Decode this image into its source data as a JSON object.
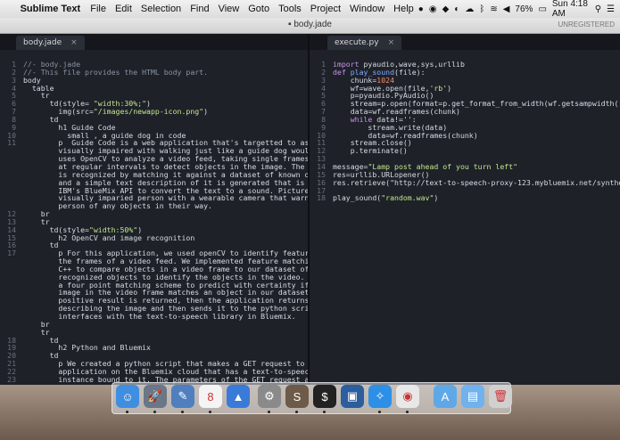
{
  "menubar": {
    "apple": "",
    "app": "Sublime Text",
    "items": [
      "File",
      "Edit",
      "Selection",
      "Find",
      "View",
      "Goto",
      "Tools",
      "Project",
      "Window",
      "Help"
    ],
    "battery": "76%",
    "clock": "Sun 4:18 AM"
  },
  "window": {
    "title": "body.jade",
    "unregistered": "UNREGISTERED"
  },
  "tabs": {
    "left": "body.jade",
    "right": "execute.py",
    "close": "×"
  },
  "left_lines": [
    "1",
    "2",
    "3",
    "4",
    "5",
    "6",
    "7",
    "8",
    "9",
    "10",
    "11",
    "",
    "",
    "",
    "",
    "",
    "",
    "",
    "",
    "12",
    "13",
    "14",
    "15",
    "16",
    "17",
    "",
    "",
    "",
    "",
    "",
    "",
    "",
    "",
    "",
    "",
    "18",
    "19",
    "20",
    "21",
    "22",
    "23"
  ],
  "left_code": [
    "//- body.jade",
    "//- This file provides the HTML body part.",
    "body",
    "  table",
    "    tr",
    "      td(style= \"width:30%;\")",
    "        img(src=\"/images/newapp-icon.png\")",
    "      td",
    "        h1 Guide Code",
    "          small , a guide dog in code",
    "        p  Guide Code is a web application that's targetted to assist the",
    "        visually impaired with walking just like a guide dog would. It",
    "        uses OpenCV to analyze a video feed, taking single frames from it",
    "        at regular intervals to detect objects in the image. The object",
    "        is recognized by matching it against a dataset of known objects,",
    "        and a simple text description of it is generated that is sent to",
    "        IBM's BlueMix API to convert the text to a sound. Picture a",
    "        visually imparied person with a wearable camera that warns the",
    "        person of any objects in their way.",
    "    br",
    "    tr",
    "      td(style=\"width:50%\")",
    "        h2 OpenCV and image recognition",
    "      td",
    "        p For this application, we used openCV to identify features in",
    "        the frames of a video feed. We implemented feature matching using",
    "        C++ to compare objects in a video frame to our dataset of",
    "        recognized objects to identify the objects in the video. We used",
    "        a four point matching scheme to predict with certainty if the",
    "        image in the video frame matches an object in our dataset. If a",
    "        positive result is returned, then the application returns a text",
    "        describing the image and then sends it to the python script that",
    "        interfaces with the text-to-speech library in Bluemix.",
    "    br",
    "    tr",
    "      td",
    "        h2 Python and Bluemix",
    "      td",
    "        p We created a python script that makes a GET request to the web",
    "        application on the Bluemix cloud that has a text-to-speech",
    "        instance bound to it. The parameters of the GET request are the"
  ],
  "right_lines": [
    "1",
    "2",
    "3",
    "4",
    "5",
    "6",
    "7",
    "8",
    "9",
    "10",
    "11",
    "12",
    "13",
    "14",
    "15",
    "16",
    "17",
    "18"
  ],
  "right_code": [
    "import pyaudio,wave,sys,urllib",
    "def play_sound(file):",
    "    chunk=1024",
    "    wf=wave.open(file,'rb')",
    "    p=pyaudio.PyAudio()",
    "    stream=p.open(format=p.get_format_from_width(wf.getsampwidth()),channe",
    "    data=wf.readframes(chunk)",
    "    while data!='':",
    "        stream.write(data)",
    "        data=wf.readframes(chunk)",
    "    stream.close()",
    "    p.terminate()",
    "",
    "message=\"Lamp post ahead of you turn left\"",
    "res=urllib.URLopener()",
    "res.retrieve(\"http://text-to-speech-proxy-123.mybluemix.net/synthesize?tex",
    "",
    "play_sound(\"random.wav\")"
  ],
  "dock": [
    {
      "name": "finder-icon",
      "color": "#3f8ee0",
      "glyph": "☺"
    },
    {
      "name": "launchpad-icon",
      "color": "#6b7686",
      "glyph": "🚀"
    },
    {
      "name": "photo-app-icon",
      "color": "#4f7fbf",
      "glyph": "✎"
    },
    {
      "name": "calendar-icon",
      "color": "#f4f4f4",
      "glyph": "8"
    },
    {
      "name": "keynote-icon",
      "color": "#3a7ad8",
      "glyph": "▲"
    },
    {
      "name": "system-preferences-icon",
      "color": "#8a8a8a",
      "glyph": "⚙"
    },
    {
      "name": "sublime-text-icon",
      "color": "#6e5a48",
      "glyph": "S"
    },
    {
      "name": "terminal-icon",
      "color": "#222",
      "glyph": "$"
    },
    {
      "name": "virtualbox-icon",
      "color": "#2c5d9c",
      "glyph": "▣"
    },
    {
      "name": "safari-icon",
      "color": "#2d8fe6",
      "glyph": "✧"
    },
    {
      "name": "chrome-icon",
      "color": "#e8e8e8",
      "glyph": "◉"
    },
    {
      "name": "folder-applications-icon",
      "color": "#5fa8e8",
      "glyph": "A"
    },
    {
      "name": "folder-documents-icon",
      "color": "#6fb2ee",
      "glyph": "▤"
    },
    {
      "name": "trash-icon",
      "color": "#d0d0d0",
      "glyph": "🗑"
    }
  ]
}
